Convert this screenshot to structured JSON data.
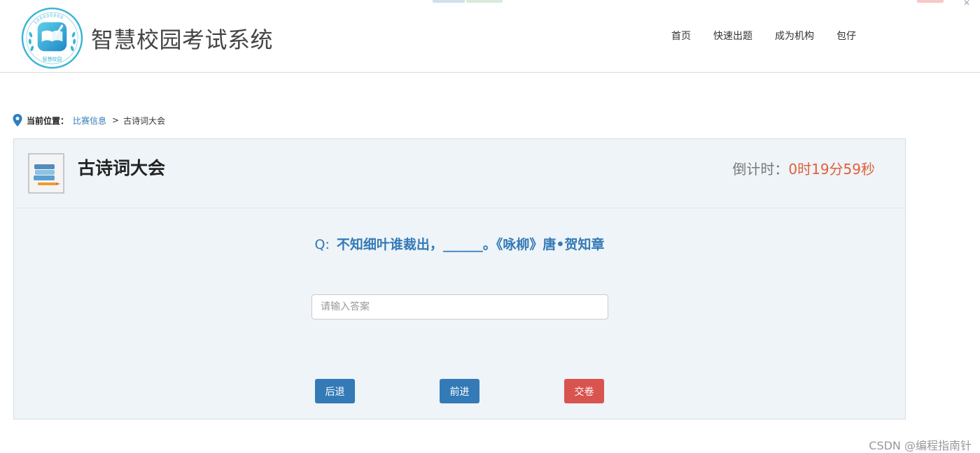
{
  "header": {
    "site_title": "智慧校园考试系统",
    "logo_text": "智慧校园",
    "logo_arc_text": "100000000",
    "nav": [
      "首页",
      "快速出题",
      "成为机构",
      "包仔"
    ]
  },
  "breadcrumb": {
    "label": "当前位置：",
    "link": "比赛信息",
    "separator": ">",
    "current": "古诗词大会"
  },
  "exam": {
    "title": "古诗词大会",
    "countdown_label": "倒计时：",
    "countdown_value": "0时19分59秒"
  },
  "question": {
    "prefix": "Q:",
    "text": "不知细叶谁裁出，______。《咏柳》唐•贺知章"
  },
  "answer": {
    "placeholder": "请输入答案",
    "value": ""
  },
  "buttons": {
    "back": "后退",
    "next": "前进",
    "submit": "交卷"
  },
  "watermark": "CSDN @编程指南针",
  "colors": {
    "primary": "#337ab7",
    "danger": "#d9534f",
    "countdown": "#e0603a",
    "panel_bg": "#eef4f8",
    "logo_teal": "#3bb5d6"
  },
  "icons": {
    "logo": "open-book-quill-logo",
    "breadcrumb": "location-pin-icon",
    "exam": "book-stack-icon"
  }
}
